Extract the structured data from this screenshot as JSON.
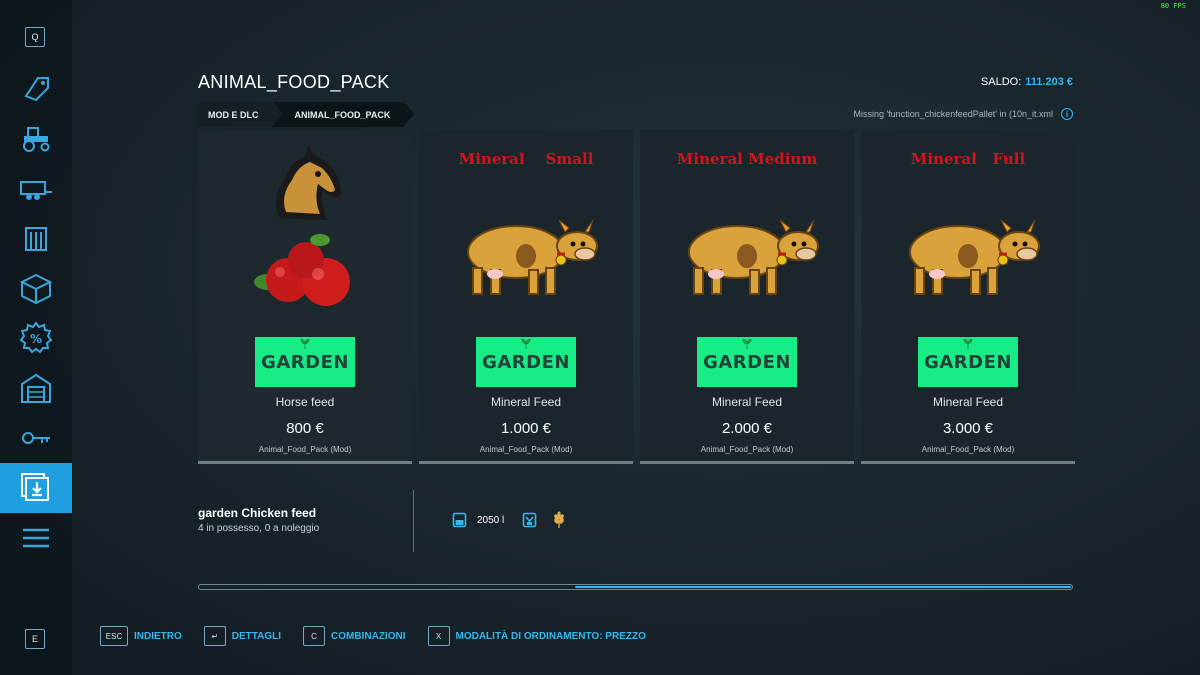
{
  "fps": "80 FPS",
  "sidebar": {
    "top_key": "Q",
    "bottom_key": "E",
    "items": [
      {
        "icon": "price-tag-icon"
      },
      {
        "icon": "tractor-icon"
      },
      {
        "icon": "trailer-icon"
      },
      {
        "icon": "silo-icon"
      },
      {
        "icon": "box-icon"
      },
      {
        "icon": "percent-badge-icon"
      },
      {
        "icon": "garage-icon"
      },
      {
        "icon": "key-icon"
      },
      {
        "icon": "download-mods-icon",
        "active": true
      },
      {
        "icon": "menu-icon"
      }
    ]
  },
  "header": {
    "title": "ANIMAL_FOOD_PACK",
    "saldo_label": "SALDO:",
    "saldo_value": "111.203 €",
    "breadcrumb": [
      "MOD E DLC",
      "ANIMAL_FOOD_PACK"
    ],
    "warning": "Missing 'function_chickenfeedPallet' in (10n_it.xml"
  },
  "cards": [
    {
      "title": "",
      "name": "Horse feed",
      "price": "800 €",
      "source": "Animal_Food_Pack (Mod)",
      "logo": "GARDEN"
    },
    {
      "title": "Mineral    Small",
      "name": "Mineral Feed",
      "price": "1.000 €",
      "source": "Animal_Food_Pack (Mod)",
      "logo": "GARDEN"
    },
    {
      "title": "Mineral Medium",
      "name": "Mineral Feed",
      "price": "2.000 €",
      "source": "Animal_Food_Pack (Mod)",
      "logo": "GARDEN"
    },
    {
      "title": "Mineral   Full",
      "name": "Mineral Feed",
      "price": "3.000 €",
      "source": "Animal_Food_Pack (Mod)",
      "logo": "GARDEN"
    }
  ],
  "detail": {
    "name": "garden Chicken feed",
    "owned": "4 in possesso, 0 a noleggio",
    "capacity": "2050 l"
  },
  "scroll": {
    "position_fraction": 0.43,
    "visible_fraction": 0.57
  },
  "footer": [
    {
      "key": "ESC",
      "label": "INDIETRO"
    },
    {
      "key": "↵",
      "label": "DETTAGLI"
    },
    {
      "key": "C",
      "label": "COMBINAZIONI"
    },
    {
      "key": "X",
      "label": "MODALITÀ DI ORDINAMENTO: PREZZO"
    }
  ],
  "colors": {
    "accent": "#32b8ef",
    "active": "#1f9fe0",
    "garden_green": "#17ec86",
    "title_red": "#d4141a"
  }
}
